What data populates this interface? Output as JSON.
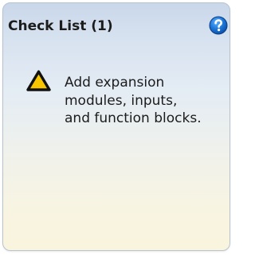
{
  "panel": {
    "title": "Check List (1)",
    "help_icon": "help-icon",
    "accent_color": "#1e78d8"
  },
  "items": [
    {
      "icon": "warning-icon",
      "icon_color": "#f7c600",
      "lines": [
        "Add expansion",
        "modules, inputs,",
        "and function blocks."
      ]
    }
  ]
}
